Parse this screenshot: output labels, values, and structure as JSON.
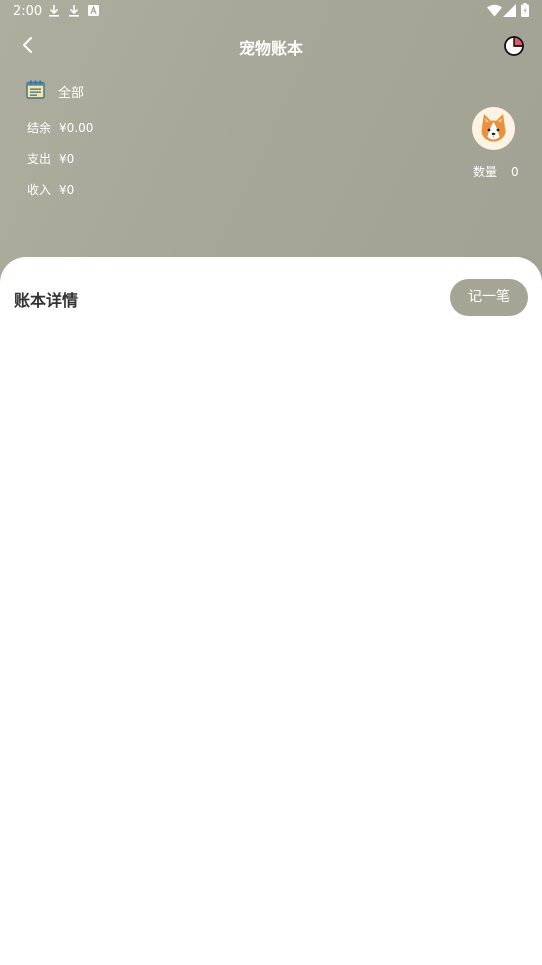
{
  "status_bar": {
    "time": "2:00",
    "icons": [
      "download-icon",
      "download-icon",
      "a-icon",
      "wifi-icon",
      "signal-icon",
      "battery-icon"
    ]
  },
  "nav": {
    "title": "宠物账本",
    "back_icon": "back-chevron-icon",
    "stats_icon": "pie-chart-icon"
  },
  "summary": {
    "filter_label": "全部",
    "balance_label": "结余",
    "balance_value": "¥0.00",
    "expense_label": "支出",
    "expense_value": "¥0",
    "income_label": "收入",
    "income_value": "¥0"
  },
  "pet": {
    "avatar_icon": "corgi-avatar-icon",
    "count_label": "数量",
    "count_value": "0"
  },
  "details": {
    "title": "账本详情",
    "add_button_label": "记一笔"
  },
  "colors": {
    "header": "#a7a799",
    "accent_button": "#a5a596",
    "chart_slice": "#e05a6a"
  }
}
